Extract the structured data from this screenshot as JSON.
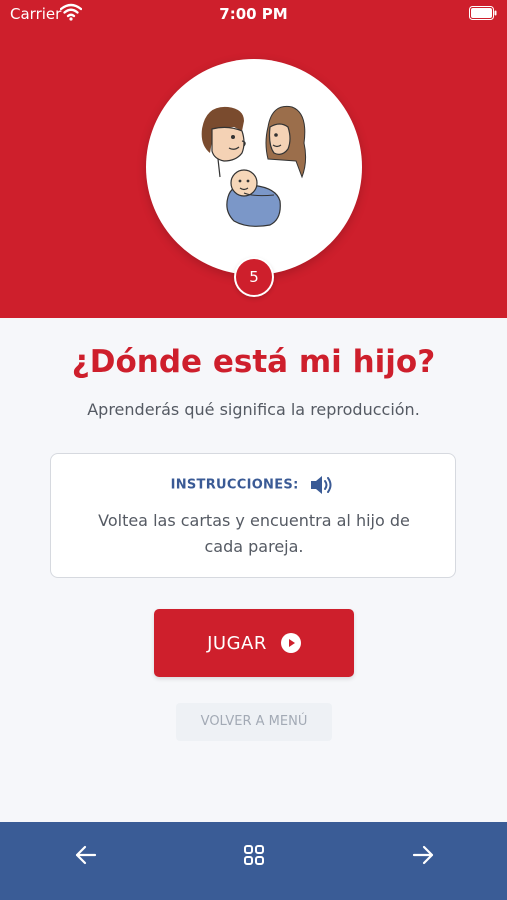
{
  "status_bar": {
    "carrier": "Carrier",
    "time": "7:00 PM"
  },
  "lesson": {
    "level": "5",
    "title": "¿Dónde está mi hijo?",
    "subtitle": "Aprenderás qué significa la reproducción."
  },
  "instructions": {
    "label": "INSTRUCCIONES:",
    "text": "Voltea las cartas y encuentra al hijo de cada pareja."
  },
  "buttons": {
    "play": "JUGAR",
    "menu": "VOLVER A MENÚ"
  },
  "bottom_nav": {
    "items": [
      "arrow-left-icon",
      "grid-icon",
      "arrow-right-icon"
    ]
  },
  "colors": {
    "primary_red": "#ce1f2c",
    "nav_blue": "#3a5c96",
    "instructions_blue": "#3a5a95",
    "background": "#f6f7fa"
  }
}
